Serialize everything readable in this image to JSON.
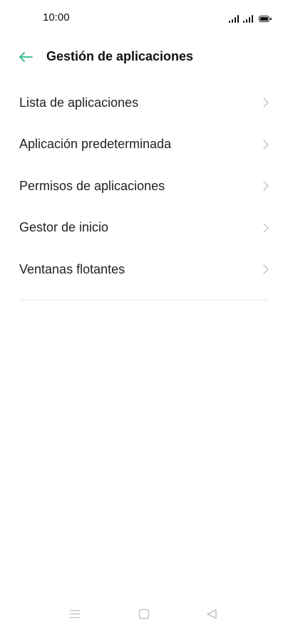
{
  "status_bar": {
    "time": "10:00"
  },
  "header": {
    "title": "Gestión de aplicaciones",
    "back_icon": "arrow-left-icon",
    "accent_color": "#2bb98c"
  },
  "menu": {
    "items": [
      {
        "label": "Lista de aplicaciones"
      },
      {
        "label": "Aplicación predeterminada"
      },
      {
        "label": "Permisos de aplicaciones"
      },
      {
        "label": "Gestor de inicio"
      },
      {
        "label": "Ventanas flotantes"
      }
    ],
    "chevron_icon": "chevron-right-icon"
  },
  "nav_bar": {
    "menu_icon": "menu-lines-icon",
    "home_icon": "square-home-icon",
    "back_icon": "triangle-back-icon"
  }
}
